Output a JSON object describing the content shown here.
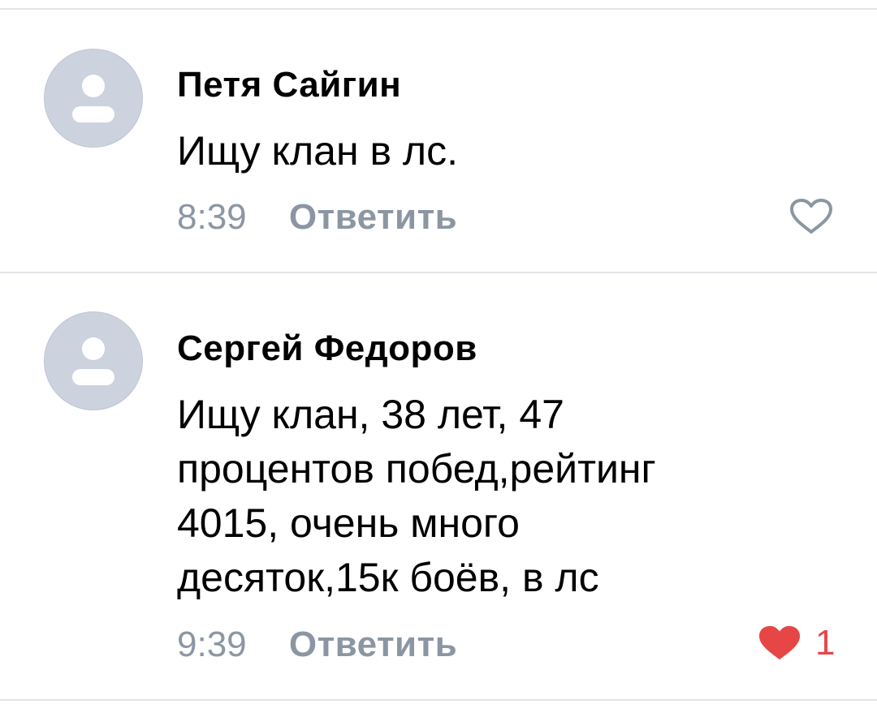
{
  "comments": [
    {
      "author": "Петя Сайгин",
      "text": "Ищу клан в лс.",
      "time": "8:39",
      "reply_label": "Ответить",
      "liked": false,
      "likes": ""
    },
    {
      "author": "Сергей Федоров",
      "text": "Ищу клан, 38 лет, 47\nпроцентов побед,рейтинг\n4015, очень много\nдесяток,15к боёв, в лс",
      "time": "9:39",
      "reply_label": "Ответить",
      "liked": true,
      "likes": "1"
    }
  ],
  "colors": {
    "avatar_bg": "#ccd2de",
    "avatar_glyph": "#ffffff",
    "meta_text": "#8c96a3",
    "like_active": "#e64646",
    "like_inactive": "#8c96a3",
    "divider": "#e3e4e8"
  },
  "icons": {
    "avatar": "user-silhouette-icon",
    "like_empty": "heart-outline-icon",
    "like_filled": "heart-filled-icon"
  }
}
